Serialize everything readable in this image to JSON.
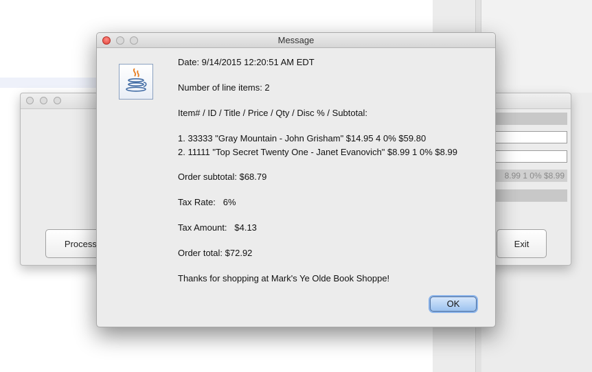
{
  "dialog": {
    "title": "Message",
    "lines": {
      "date": "Date: 9/14/2015 12:20:51 AM EDT",
      "count": "Number of line items: 2",
      "header": "Item# / ID / Title / Price / Qty / Disc % / Subtotal:",
      "item1": "1. 33333 \"Gray Mountain - John Grisham\" $14.95 4 0% $59.80",
      "item2": "2. 11111 \"Top Secret Twenty One - Janet Evanovich\" $8.99 1 0% $8.99",
      "subtotal": "Order subtotal: $68.79",
      "tax_rate": "Tax Rate:   6%",
      "tax_amount": "Tax Amount:   $4.13",
      "total": "Order total: $72.92",
      "thanks": "Thanks for shopping at Mark's Ye Olde Book Shoppe!"
    },
    "ok_label": "OK"
  },
  "background_window": {
    "process_button_label": "Process I",
    "exit_button_label": "Exit",
    "summary_field_text": "8.99 1 0% $8.99"
  },
  "colors": {
    "close_light": "#e0443a",
    "ok_button": "#9cc2ef"
  },
  "icons": [
    "java-cup-icon"
  ]
}
